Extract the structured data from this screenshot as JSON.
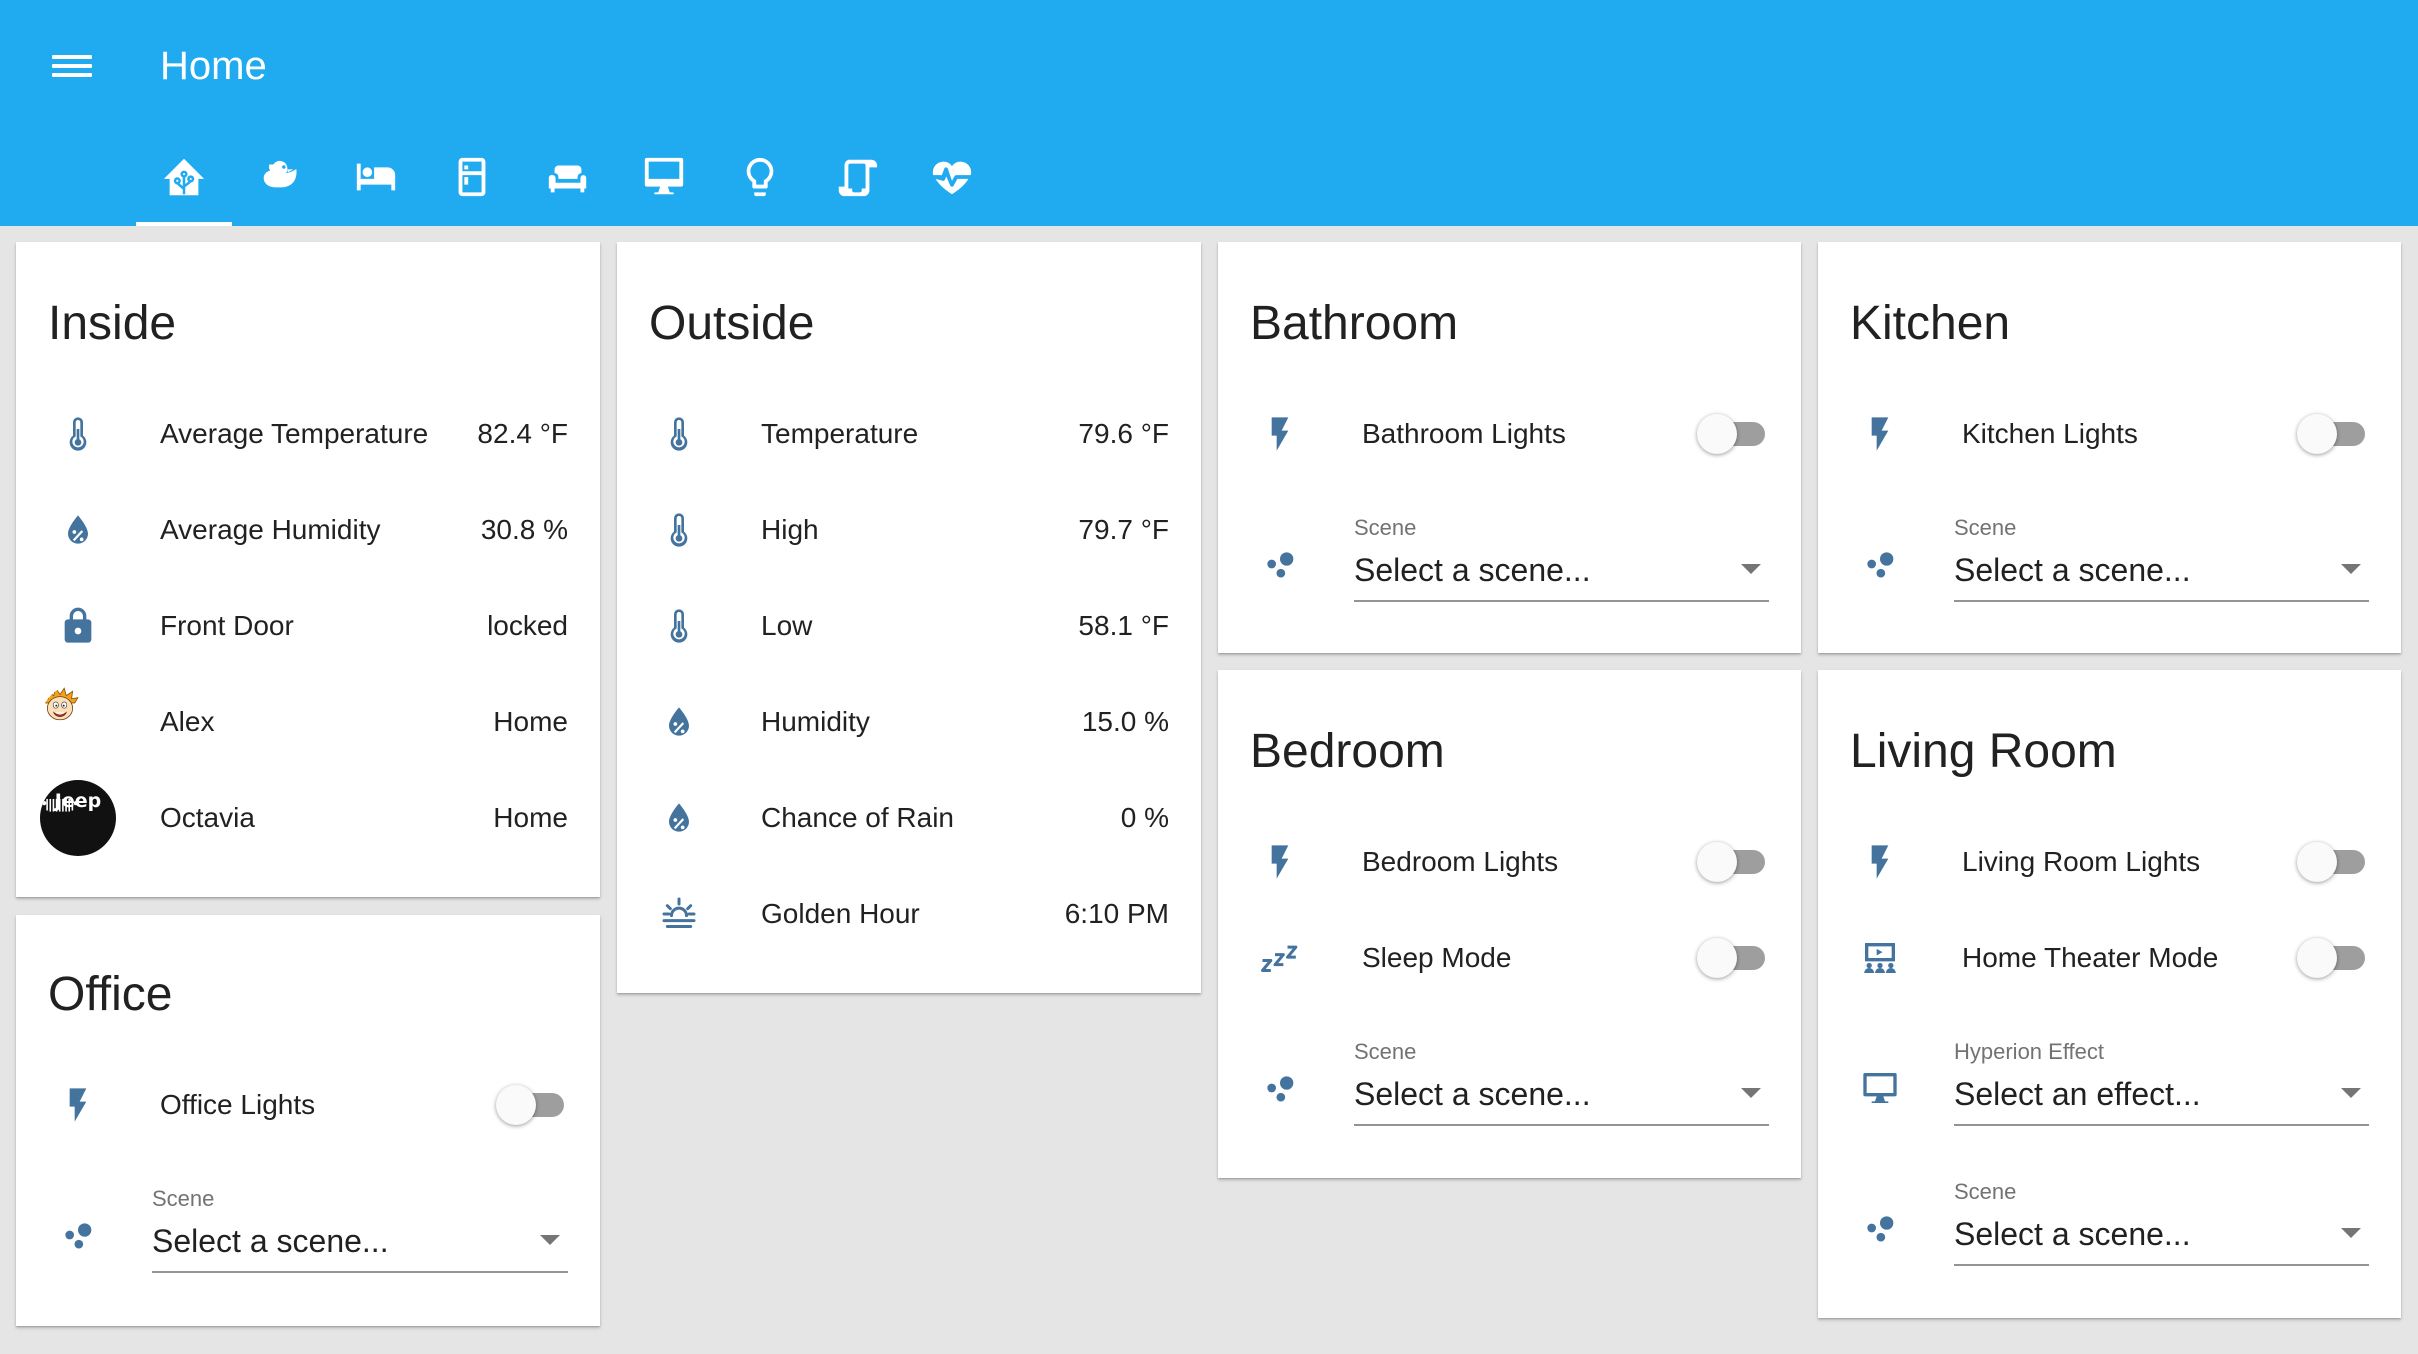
{
  "app": {
    "title": "Home"
  },
  "theme": {
    "header_color": "#20aaf0",
    "icon_color": "#44739e"
  },
  "tabs": [
    {
      "icon": "home-assistant-icon",
      "active": true
    },
    {
      "icon": "duck-icon"
    },
    {
      "icon": "hotel-bed-icon"
    },
    {
      "icon": "fridge-icon"
    },
    {
      "icon": "sofa-icon"
    },
    {
      "icon": "desktop-mac-icon"
    },
    {
      "icon": "lightbulb-outline-icon"
    },
    {
      "icon": "scroll-icon"
    },
    {
      "icon": "heart-pulse-icon"
    }
  ],
  "inside": {
    "title": "Inside",
    "rows": [
      {
        "icon": "thermometer-icon",
        "label": "Average Temperature",
        "value": "82.4 °F"
      },
      {
        "icon": "water-percent-icon",
        "label": "Average Humidity",
        "value": "30.8 %"
      },
      {
        "icon": "lock-icon",
        "label": "Front Door",
        "value": "locked"
      },
      {
        "icon": "avatar-alex",
        "label": "Alex",
        "value": "Home"
      },
      {
        "icon": "avatar-jeep",
        "label": "Octavia",
        "value": "Home"
      }
    ],
    "jeep_text": "Jeep"
  },
  "office": {
    "title": "Office",
    "lights": {
      "label": "Office Lights",
      "on": false
    },
    "scene": {
      "label": "Scene",
      "value": "Select a scene..."
    }
  },
  "outside": {
    "title": "Outside",
    "rows": [
      {
        "icon": "thermometer-icon",
        "label": "Temperature",
        "value": "79.6 °F"
      },
      {
        "icon": "thermometer-icon",
        "label": "High",
        "value": "79.7 °F"
      },
      {
        "icon": "thermometer-icon",
        "label": "Low",
        "value": "58.1 °F"
      },
      {
        "icon": "water-percent-icon",
        "label": "Humidity",
        "value": "15.0 %"
      },
      {
        "icon": "water-percent-icon",
        "label": "Chance of Rain",
        "value": "0 %"
      },
      {
        "icon": "weather-sunset-icon",
        "label": "Golden Hour",
        "value": "6:10 PM"
      }
    ]
  },
  "bathroom": {
    "title": "Bathroom",
    "lights": {
      "label": "Bathroom Lights",
      "on": false
    },
    "scene": {
      "label": "Scene",
      "value": "Select a scene..."
    }
  },
  "bedroom": {
    "title": "Bedroom",
    "lights": {
      "label": "Bedroom Lights",
      "on": false
    },
    "sleep": {
      "label": "Sleep Mode",
      "on": false
    },
    "scene": {
      "label": "Scene",
      "value": "Select a scene..."
    }
  },
  "kitchen": {
    "title": "Kitchen",
    "lights": {
      "label": "Kitchen Lights",
      "on": false
    },
    "scene": {
      "label": "Scene",
      "value": "Select a scene..."
    }
  },
  "living_room": {
    "title": "Living Room",
    "lights": {
      "label": "Living Room Lights",
      "on": false
    },
    "theater": {
      "label": "Home Theater Mode",
      "on": false
    },
    "hyperion": {
      "label": "Hyperion Effect",
      "value": "Select an effect..."
    },
    "scene": {
      "label": "Scene",
      "value": "Select a scene..."
    }
  }
}
